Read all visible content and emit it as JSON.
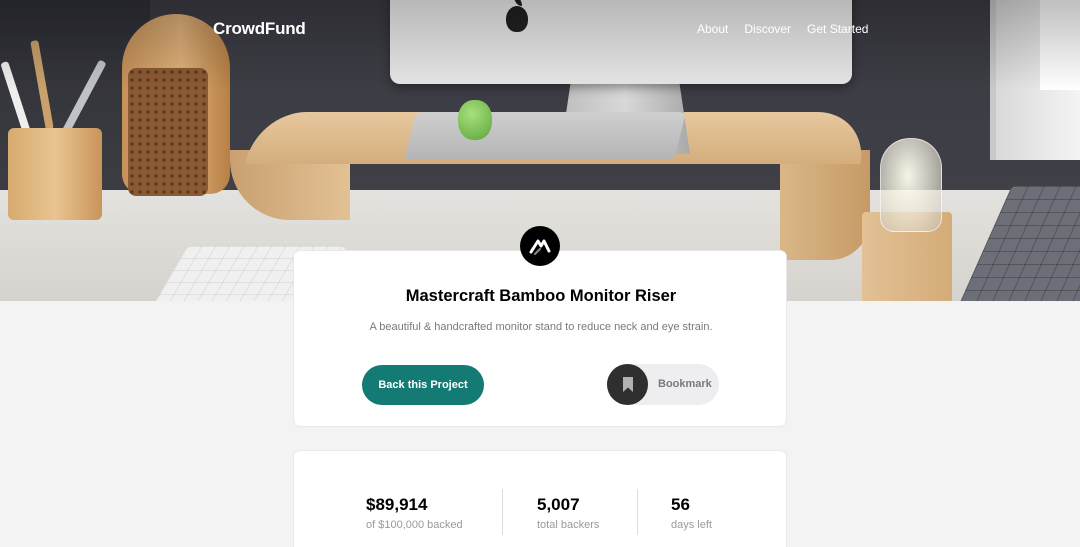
{
  "brand": {
    "name": "CrowdFund"
  },
  "nav": {
    "items": [
      {
        "label": "About"
      },
      {
        "label": "Discover"
      },
      {
        "label": "Get Started"
      }
    ]
  },
  "project": {
    "title": "Mastercraft Bamboo Monitor Riser",
    "description": "A beautiful & handcrafted monitor stand to reduce neck and eye strain.",
    "logo_icon": "mastercraft-logo-icon",
    "back_button_label": "Back this Project",
    "bookmark_label": "Bookmark",
    "bookmark_icon": "bookmark-icon"
  },
  "stats": [
    {
      "value": "$89,914",
      "label": "of $100,000 backed"
    },
    {
      "value": "5,007",
      "label": "total backers"
    },
    {
      "value": "56",
      "label": "days left"
    }
  ],
  "colors": {
    "accent": "#147b74",
    "dark": "#2f2f2f",
    "muted_text": "#7a7a7a",
    "page_background": "#f3f3f4"
  }
}
